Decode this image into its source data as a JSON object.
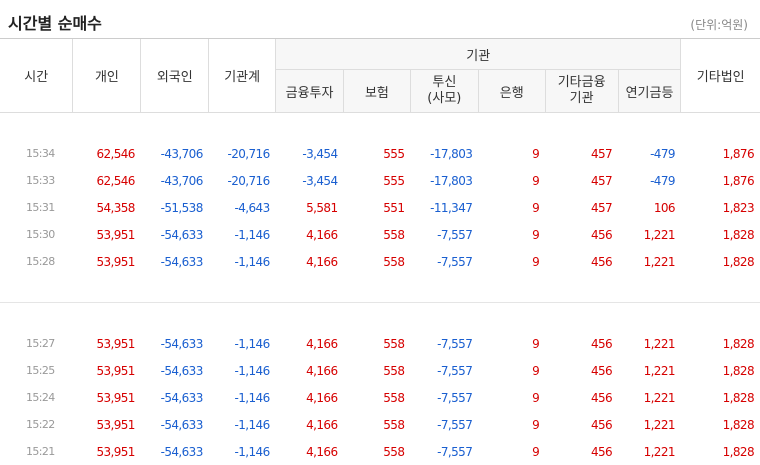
{
  "title": "시간별 순매수",
  "unit": "(단위:억원)",
  "headers": {
    "time": "시간",
    "individual": "개인",
    "foreign": "외국인",
    "institution_total": "기관계",
    "institution_group": "기관",
    "finance_invest": "금융투자",
    "insurance": "보험",
    "trust": "투신\n(사모)",
    "bank": "은행",
    "other_finance": "기타금융\n기관",
    "pension": "연기금등",
    "other_corp": "기타법인"
  },
  "group1": [
    {
      "time": "15:34",
      "v": [
        "62,546",
        "-43,706",
        "-20,716",
        "-3,454",
        "555",
        "-17,803",
        "9",
        "457",
        "-479",
        "1,876"
      ]
    },
    {
      "time": "15:33",
      "v": [
        "62,546",
        "-43,706",
        "-20,716",
        "-3,454",
        "555",
        "-17,803",
        "9",
        "457",
        "-479",
        "1,876"
      ]
    },
    {
      "time": "15:31",
      "v": [
        "54,358",
        "-51,538",
        "-4,643",
        "5,581",
        "551",
        "-11,347",
        "9",
        "457",
        "106",
        "1,823"
      ]
    },
    {
      "time": "15:30",
      "v": [
        "53,951",
        "-54,633",
        "-1,146",
        "4,166",
        "558",
        "-7,557",
        "9",
        "456",
        "1,221",
        "1,828"
      ]
    },
    {
      "time": "15:28",
      "v": [
        "53,951",
        "-54,633",
        "-1,146",
        "4,166",
        "558",
        "-7,557",
        "9",
        "456",
        "1,221",
        "1,828"
      ]
    }
  ],
  "group2": [
    {
      "time": "15:27",
      "v": [
        "53,951",
        "-54,633",
        "-1,146",
        "4,166",
        "558",
        "-7,557",
        "9",
        "456",
        "1,221",
        "1,828"
      ]
    },
    {
      "time": "15:25",
      "v": [
        "53,951",
        "-54,633",
        "-1,146",
        "4,166",
        "558",
        "-7,557",
        "9",
        "456",
        "1,221",
        "1,828"
      ]
    },
    {
      "time": "15:24",
      "v": [
        "53,951",
        "-54,633",
        "-1,146",
        "4,166",
        "558",
        "-7,557",
        "9",
        "456",
        "1,221",
        "1,828"
      ]
    },
    {
      "time": "15:22",
      "v": [
        "53,951",
        "-54,633",
        "-1,146",
        "4,166",
        "558",
        "-7,557",
        "9",
        "456",
        "1,221",
        "1,828"
      ]
    },
    {
      "time": "15:21",
      "v": [
        "53,951",
        "-54,633",
        "-1,146",
        "4,166",
        "558",
        "-7,557",
        "9",
        "456",
        "1,221",
        "1,828"
      ]
    }
  ]
}
